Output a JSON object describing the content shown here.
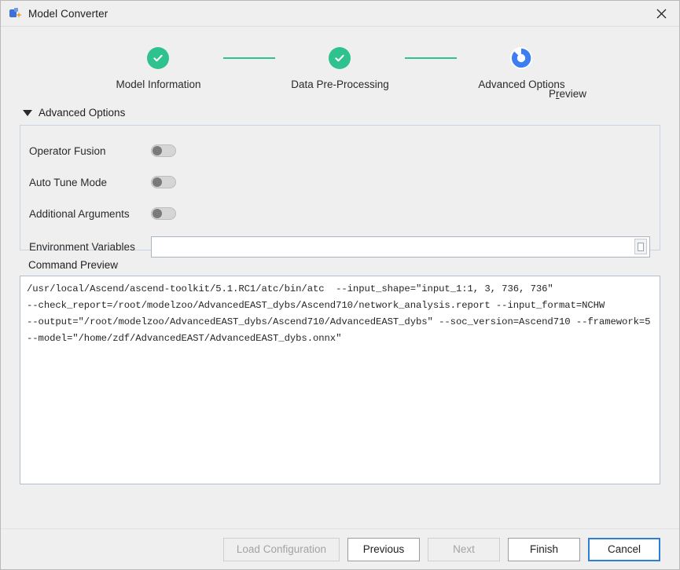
{
  "window": {
    "title": "Model Converter",
    "app_icon": "model-converter-icon",
    "close_icon": "close-icon"
  },
  "stepper": {
    "steps": [
      {
        "label": "Model Information",
        "state": "done",
        "icon": "check-icon"
      },
      {
        "label": "Data Pre-Processing",
        "state": "done",
        "icon": "check-icon"
      },
      {
        "label": "Advanced Options",
        "state": "current",
        "icon": "refresh-icon"
      }
    ],
    "preview_label": "Preview",
    "preview_mnemonic_prefix": "P",
    "preview_mnemonic_char": "r",
    "preview_mnemonic_suffix": "eview",
    "connector_color": "#2ec28e",
    "done_color": "#2ec28e",
    "current_color": "#3d7ef0"
  },
  "section": {
    "caret_icon": "caret-down-icon",
    "title": "Advanced Options"
  },
  "options": {
    "toggles": [
      {
        "label": "Operator Fusion",
        "value": "off"
      },
      {
        "label": "Auto Tune Mode",
        "value": "off"
      },
      {
        "label": "Additional Arguments",
        "value": "off"
      }
    ],
    "environment": {
      "label": "Environment Variables",
      "value": "",
      "placeholder": "",
      "edit_icon": "edit-variables-icon"
    }
  },
  "command_preview": {
    "heading": "Command Preview",
    "lines": [
      "/usr/local/Ascend/ascend-toolkit/5.1.RC1/atc/bin/atc  --input_shape=\"input_1:1, 3, 736, 736\"",
      "--check_report=/root/modelzoo/AdvancedEAST_dybs/Ascend710/network_analysis.report --input_format=NCHW",
      "--output=\"/root/modelzoo/AdvancedEAST_dybs/Ascend710/AdvancedEAST_dybs\" --soc_version=Ascend710 --framework=5",
      "--model=\"/home/zdf/AdvancedEAST/AdvancedEAST_dybs.onnx\""
    ]
  },
  "footer": {
    "buttons": [
      {
        "label": "Load Configuration",
        "state": "disabled"
      },
      {
        "label": "Previous",
        "state": "enabled"
      },
      {
        "label": "Next",
        "state": "disabled"
      },
      {
        "label": "Finish",
        "state": "enabled"
      },
      {
        "label": "Cancel",
        "state": "focused"
      }
    ]
  }
}
